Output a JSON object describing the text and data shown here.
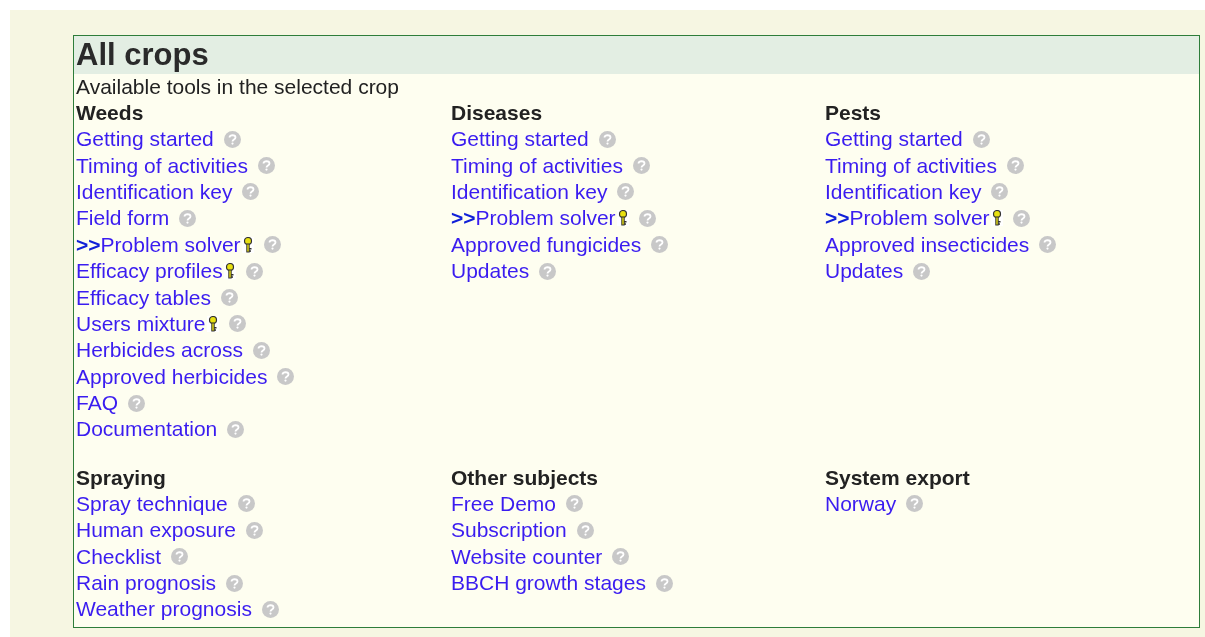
{
  "title": "All crops",
  "subtitle": "Available tools in the selected crop",
  "sections": [
    {
      "heading": "Weeds",
      "items": [
        {
          "label": "Getting started",
          "key": false
        },
        {
          "label": "Timing of activities",
          "key": false
        },
        {
          "label": "Identification key",
          "key": false
        },
        {
          "label": "Field form",
          "key": false
        },
        {
          "prefix": ">>",
          "label": "Problem solver",
          "key": true
        },
        {
          "label": "Efficacy profiles",
          "key": true
        },
        {
          "label": "Efficacy tables",
          "key": false
        },
        {
          "label": "Users mixture",
          "key": true
        },
        {
          "label": "Herbicides across",
          "key": false
        },
        {
          "label": "Approved herbicides",
          "key": false
        },
        {
          "label": "FAQ",
          "key": false
        },
        {
          "label": "Documentation",
          "key": false
        }
      ]
    },
    {
      "heading": "Diseases",
      "items": [
        {
          "label": "Getting started",
          "key": false
        },
        {
          "label": "Timing of activities",
          "key": false
        },
        {
          "label": "Identification key",
          "key": false
        },
        {
          "prefix": ">>",
          "label": "Problem solver",
          "key": true
        },
        {
          "label": "Approved fungicides",
          "key": false
        },
        {
          "label": "Updates",
          "key": false
        }
      ]
    },
    {
      "heading": "Pests",
      "items": [
        {
          "label": "Getting started",
          "key": false
        },
        {
          "label": "Timing of activities",
          "key": false
        },
        {
          "label": "Identification key",
          "key": false
        },
        {
          "prefix": ">>",
          "label": "Problem solver",
          "key": true
        },
        {
          "label": "Approved insecticides",
          "key": false
        },
        {
          "label": "Updates",
          "key": false
        }
      ]
    },
    {
      "heading": "Spraying",
      "items": [
        {
          "label": "Spray technique",
          "key": false
        },
        {
          "label": "Human exposure",
          "key": false
        },
        {
          "label": "Checklist",
          "key": false
        },
        {
          "label": "Rain prognosis",
          "key": false
        },
        {
          "label": "Weather prognosis",
          "key": false
        }
      ]
    },
    {
      "heading": "Other subjects",
      "items": [
        {
          "label": "Free Demo",
          "key": false
        },
        {
          "label": "Subscription",
          "key": false
        },
        {
          "label": "Website counter",
          "key": false
        },
        {
          "label": "BBCH growth stages",
          "key": false
        }
      ]
    },
    {
      "heading": "System export",
      "items": [
        {
          "label": "Norway",
          "key": false
        }
      ]
    }
  ]
}
